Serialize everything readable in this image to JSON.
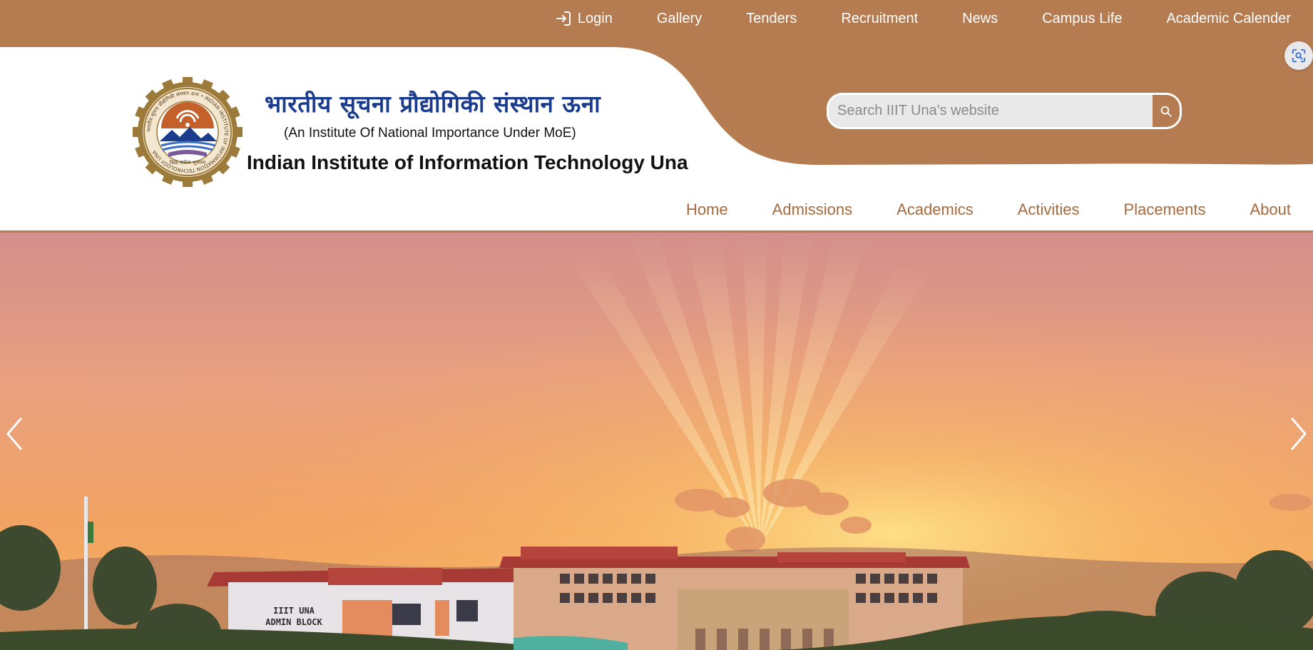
{
  "colors": {
    "brand_brown": "#b57b51",
    "nav_text": "#a66a3f",
    "hindi_blue": "#1b3c8c"
  },
  "top_bar": {
    "login": {
      "label": "Login",
      "icon": "login-icon"
    },
    "links": [
      "Gallery",
      "Tenders",
      "Recruitment",
      "News",
      "Campus Life",
      "Academic Calender"
    ]
  },
  "brand": {
    "hindi_name": "भारतीय सूचना प्रौद्योगिकी संस्थान ऊना",
    "tagline": "(An Institute Of National Importance Under MoE)",
    "english_name": "Indian Institute of Information Technology Una",
    "logo_text": {
      "ring": "भारतीय सूचना प्रौद्योगिकी संस्थान ऊना • INDIAN INSTITUTE OF INFORMATION TECHNOLOGY UNA",
      "motto": "विद्या सर्वस्य भूषणम्"
    }
  },
  "search": {
    "placeholder": "Search IIIT Una's website",
    "icon": "search-icon"
  },
  "main_nav": [
    "Home",
    "Admissions",
    "Academics",
    "Activities",
    "Placements",
    "About"
  ],
  "hero": {
    "building_sign_line1": "IIIT UNA",
    "building_sign_line2": "ADMIN BLOCK",
    "prev_icon": "chevron-left-icon",
    "next_icon": "chevron-right-icon"
  }
}
